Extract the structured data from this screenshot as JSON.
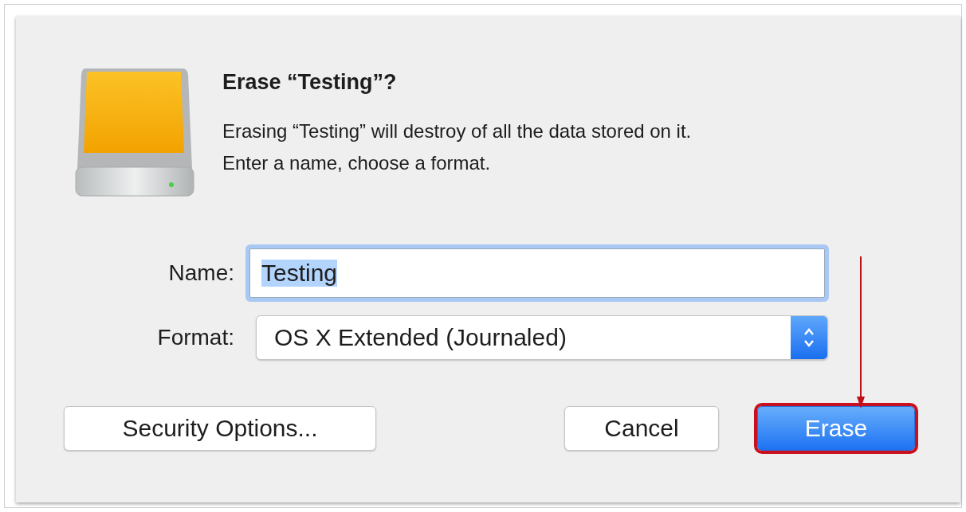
{
  "dialog": {
    "title": "Erase “Testing”?",
    "message_lines": [
      "Erasing “Testing” will destroy of all the data stored on it.",
      "Enter a name, choose a format."
    ]
  },
  "form": {
    "name_label": "Name:",
    "name_value": "Testing",
    "name_text_selected": true,
    "format_label": "Format:",
    "format_value": "OS X Extended (Journaled)"
  },
  "buttons": [
    {
      "label": "Security Options...",
      "kind": "plain",
      "highlighted": false
    },
    {
      "label": "Cancel",
      "kind": "plain",
      "highlighted": false
    },
    {
      "label": "Erase",
      "kind": "default",
      "highlighted": true
    }
  ]
}
